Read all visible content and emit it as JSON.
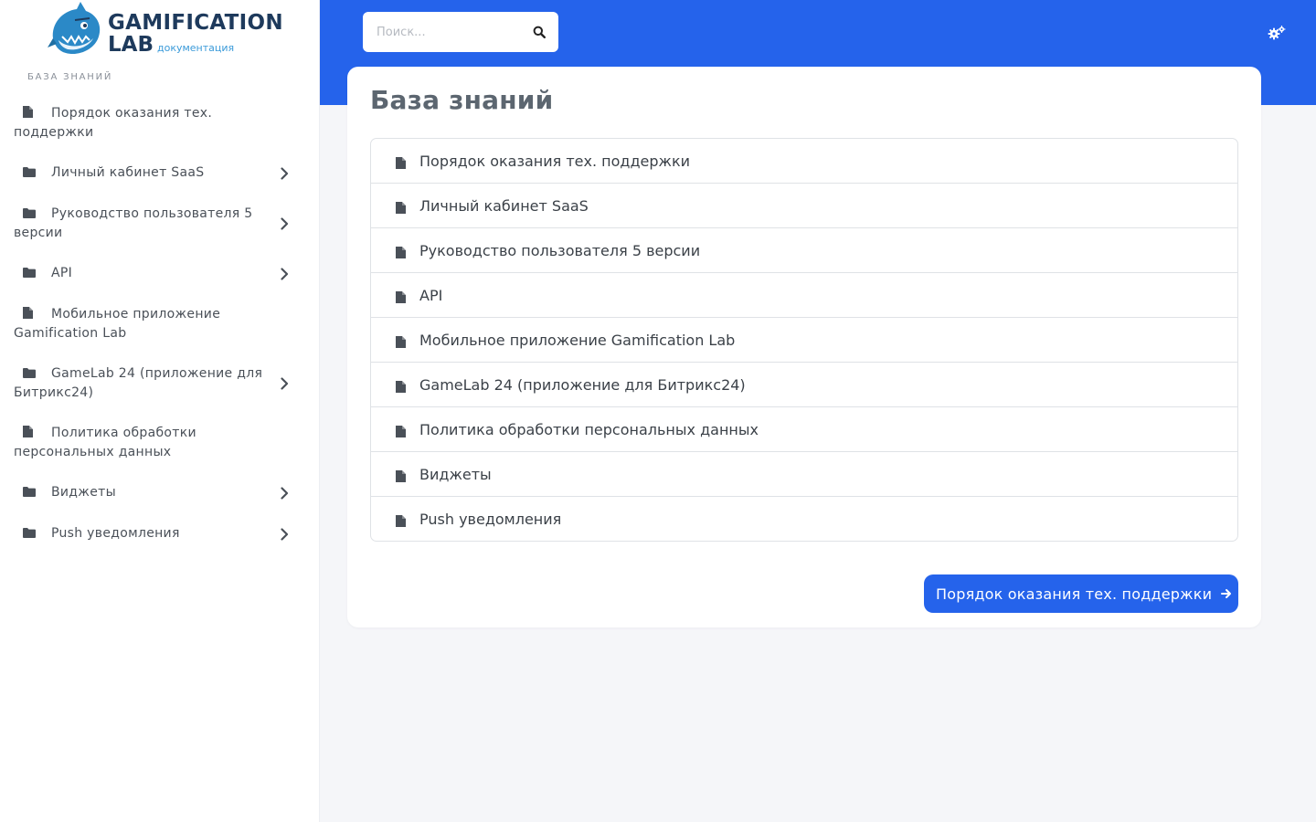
{
  "logo": {
    "line1": "GAMIFICATION",
    "line2": "LAB",
    "subtitle": "документация"
  },
  "sidebar": {
    "section_title": "БАЗА ЗНАНИЙ",
    "items": [
      {
        "label": "Порядок оказания тех. поддержки",
        "icon": "file-icon",
        "expandable": false
      },
      {
        "label": "Личный кабинет SaaS",
        "icon": "folder-icon",
        "expandable": true
      },
      {
        "label": "Руководство пользователя 5 версии",
        "icon": "folder-icon",
        "expandable": true
      },
      {
        "label": "API",
        "icon": "folder-icon",
        "expandable": true
      },
      {
        "label": "Мобильное приложение Gamification Lab",
        "icon": "file-icon",
        "expandable": false
      },
      {
        "label": "GameLab 24 (приложение для Битрикс24)",
        "icon": "folder-icon",
        "expandable": true
      },
      {
        "label": "Политика обработки персональных данных",
        "icon": "file-icon",
        "expandable": false
      },
      {
        "label": "Виджеты",
        "icon": "folder-icon",
        "expandable": true
      },
      {
        "label": "Push уведомления",
        "icon": "folder-icon",
        "expandable": true
      }
    ]
  },
  "header": {
    "search_placeholder": "Поиск...",
    "search_icon": "search-icon",
    "settings_icon": "gears-icon",
    "accent_color": "#2563eb"
  },
  "main": {
    "title": "База знаний",
    "items": [
      "Порядок оказания тех. поддержки",
      "Личный кабинет SaaS",
      "Руководство пользователя 5 версии",
      "API",
      "Мобильное приложение Gamification Lab",
      "GameLab 24 (приложение для Битрикс24)",
      "Политика обработки персональных данных",
      "Виджеты",
      "Push уведомления"
    ],
    "next_button": "Порядок оказания тех. поддержки"
  }
}
